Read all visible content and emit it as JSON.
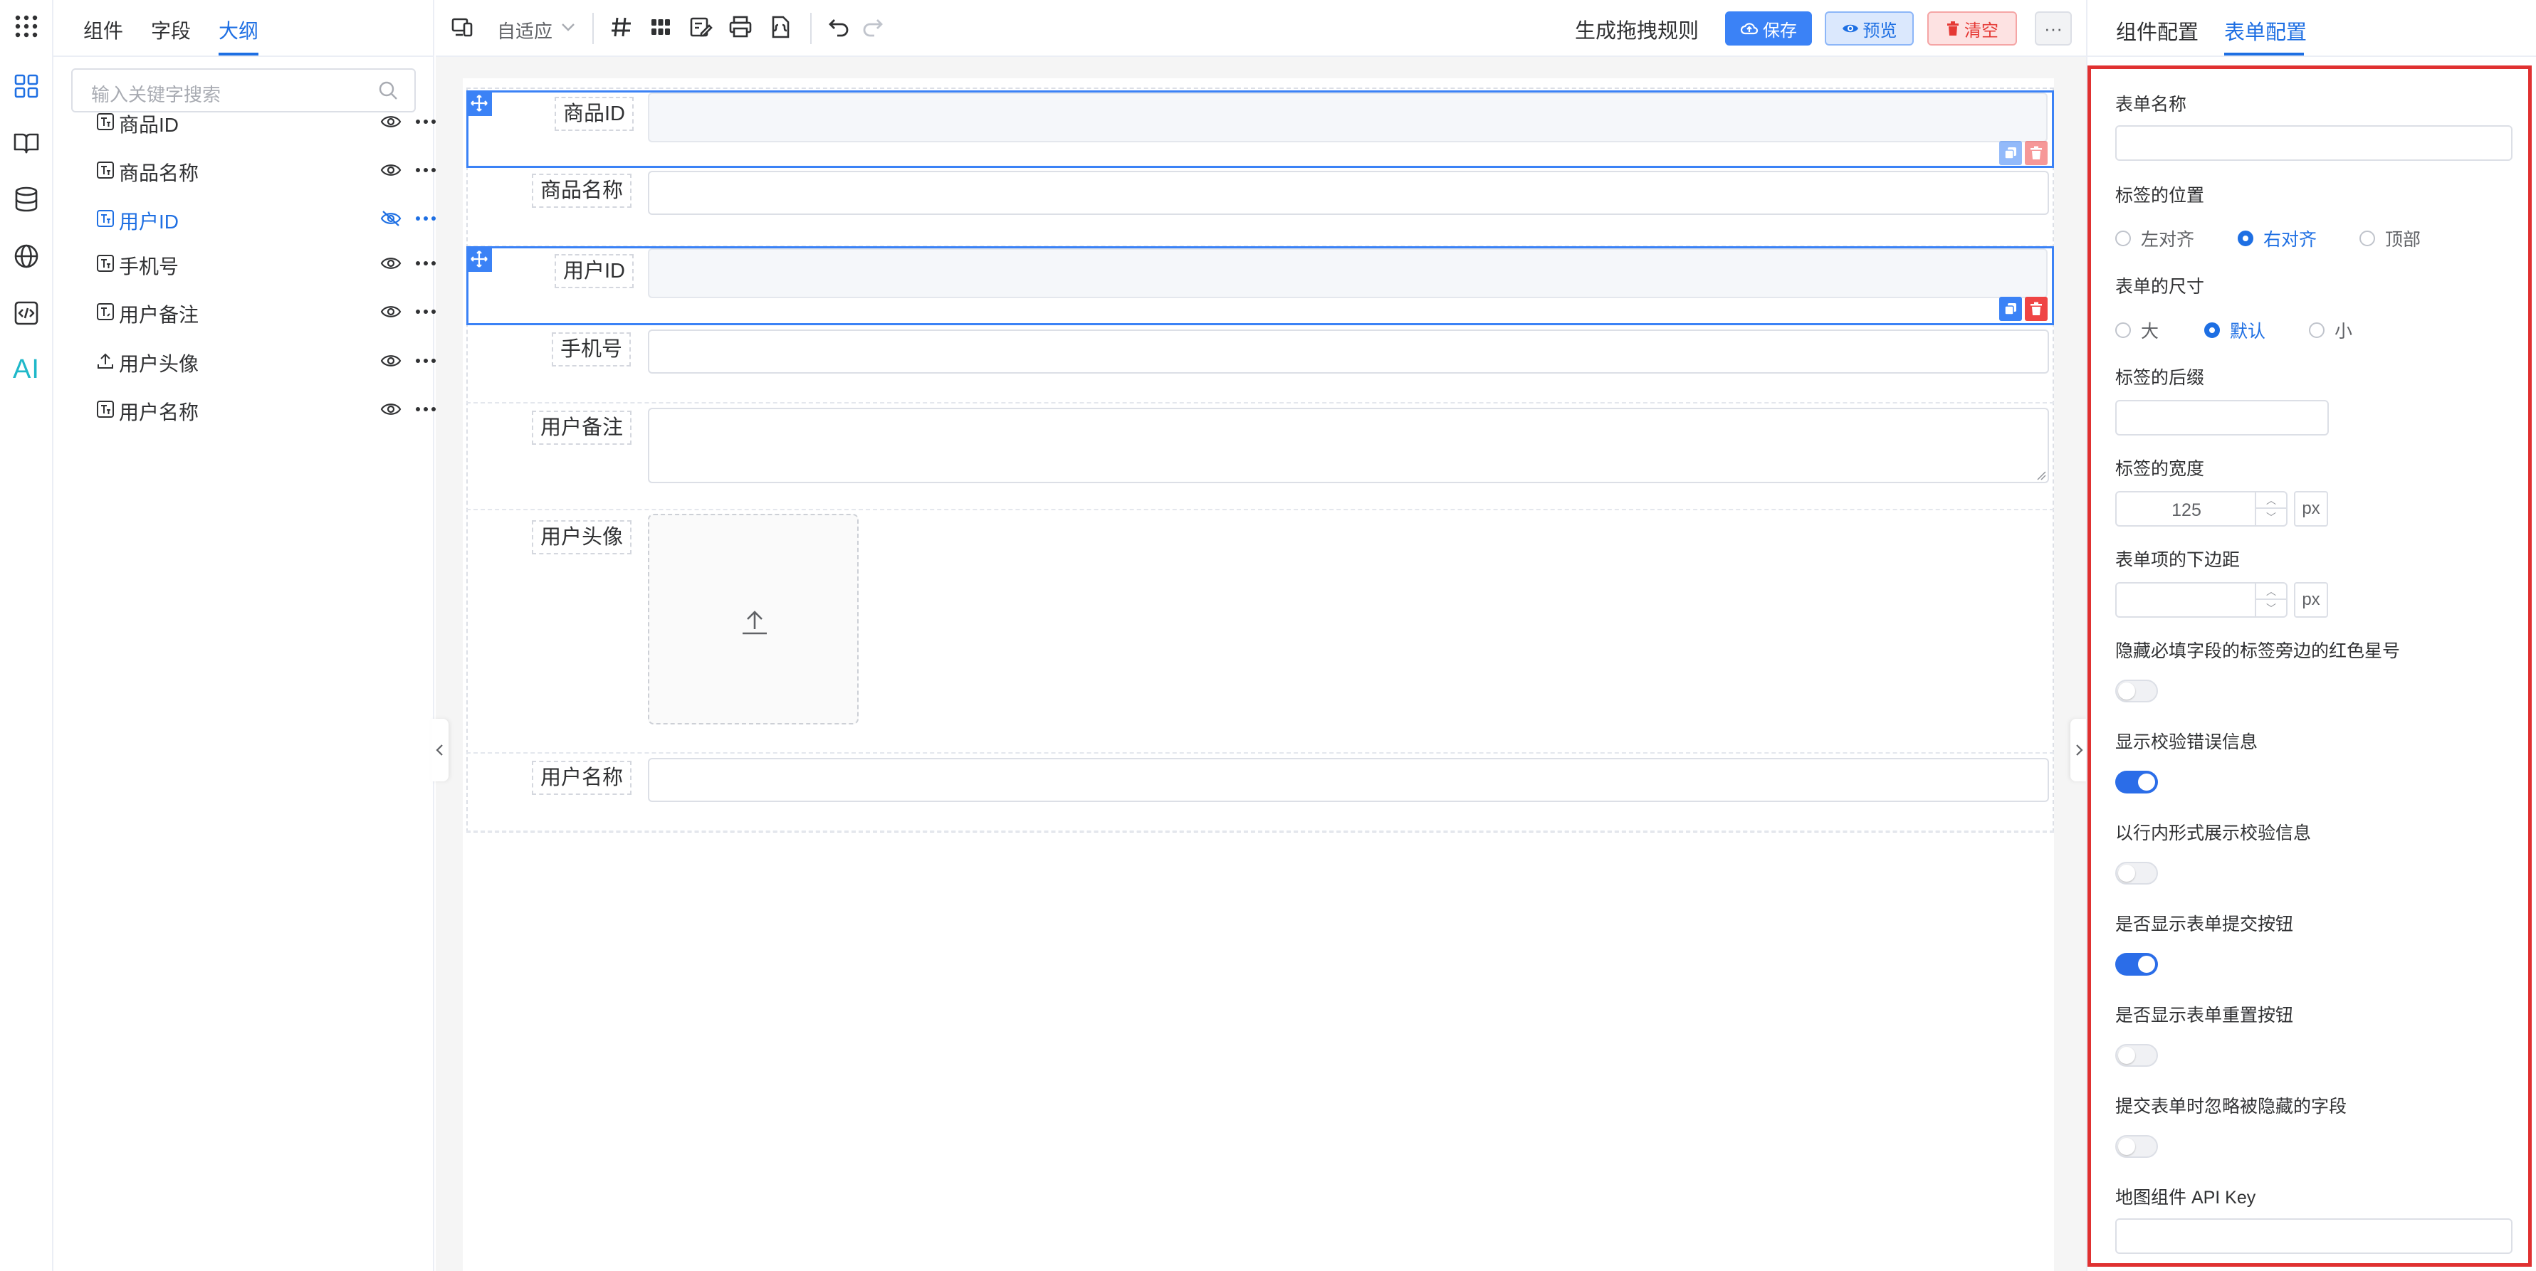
{
  "left_tabs": [
    {
      "label": "组件"
    },
    {
      "label": "字段"
    },
    {
      "label": "大纲"
    }
  ],
  "search": {
    "placeholder": "输入关键字搜索"
  },
  "outline": [
    {
      "label": "商品ID",
      "icon": "text-field-icon",
      "visible": true
    },
    {
      "label": "商品名称",
      "icon": "text-field-icon",
      "visible": true
    },
    {
      "label": "用户ID",
      "icon": "text-field-icon",
      "visible": false,
      "active": true
    },
    {
      "label": "手机号",
      "icon": "text-field-icon",
      "visible": true
    },
    {
      "label": "用户备注",
      "icon": "textarea-icon",
      "visible": true
    },
    {
      "label": "用户头像",
      "icon": "upload-icon",
      "visible": true
    },
    {
      "label": "用户名称",
      "icon": "text-field-icon",
      "visible": true
    }
  ],
  "toolbar": {
    "device_label": "自适应",
    "generate_rule": "生成拖拽规则",
    "save": "保存",
    "preview": "预览",
    "clear": "清空",
    "more": "···"
  },
  "form_fields": [
    {
      "label": "商品ID",
      "disabled": true,
      "selected": true
    },
    {
      "label": "商品名称",
      "disabled": false
    },
    {
      "label": "用户ID",
      "disabled": true,
      "selected": true
    },
    {
      "label": "手机号",
      "disabled": false
    },
    {
      "label": "用户备注",
      "type": "textarea"
    },
    {
      "label": "用户头像",
      "type": "upload"
    },
    {
      "label": "用户名称",
      "disabled": false
    }
  ],
  "right_tabs": [
    {
      "label": "组件配置"
    },
    {
      "label": "表单配置"
    }
  ],
  "config": {
    "form_name": {
      "label": "表单名称",
      "value": ""
    },
    "label_position": {
      "label": "标签的位置",
      "options": [
        "左对齐",
        "右对齐",
        "顶部"
      ],
      "selected": "右对齐"
    },
    "form_size": {
      "label": "表单的尺寸",
      "options": [
        "大",
        "默认",
        "小"
      ],
      "selected": "默认"
    },
    "label_suffix": {
      "label": "标签的后缀",
      "value": ""
    },
    "label_width": {
      "label": "标签的宽度",
      "value": "125",
      "unit": "px"
    },
    "item_margin": {
      "label": "表单项的下边距",
      "value": "",
      "unit": "px"
    },
    "hide_required": {
      "label": "隐藏必填字段的标签旁边的红色星号",
      "on": false
    },
    "show_error": {
      "label": "显示校验错误信息",
      "on": true
    },
    "inline_error": {
      "label": "以行内形式展示校验信息",
      "on": false
    },
    "show_submit": {
      "label": "是否显示表单提交按钮",
      "on": true
    },
    "show_reset": {
      "label": "是否显示表单重置按钮",
      "on": false
    },
    "ignore_hidden": {
      "label": "提交表单时忽略被隐藏的字段",
      "on": false
    },
    "map_key": {
      "label": "地图组件 API Key",
      "value": ""
    }
  },
  "colors": {
    "accent": "#1e6fe3",
    "danger": "#e53935",
    "highlight_box": "#e03131"
  }
}
